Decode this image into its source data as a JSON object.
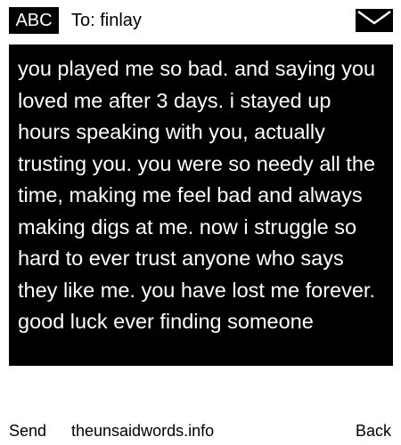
{
  "header": {
    "input_mode": "ABC",
    "recipient": "To: finlay",
    "icon": "envelope-icon"
  },
  "message": {
    "body": "you played me so bad. and saying you loved me after 3 days. i stayed up hours speaking with you, actually trusting you. you were so needy all the time, making me feel bad and always making digs at me. now i struggle so hard to ever trust anyone who says they like me. you have lost me forever. good luck ever finding someone"
  },
  "softkeys": {
    "left": "Send",
    "center": "theunsaidwords.info",
    "right": "Back"
  },
  "colors": {
    "background": "#ffffff",
    "message_background": "#000000",
    "message_text": "#ffffff"
  }
}
